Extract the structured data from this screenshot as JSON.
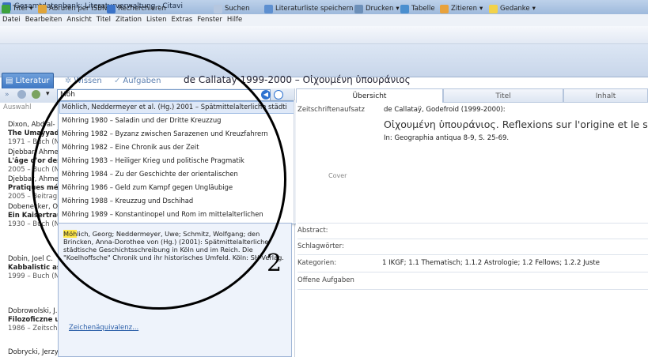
{
  "window": {
    "title": "Gesamtdatenbank: Literaturverwaltung - Citavi"
  },
  "menu": [
    "Datei",
    "Bearbeiten",
    "Ansicht",
    "Titel",
    "Zitation",
    "Listen",
    "Extras",
    "Fenster",
    "Hilfe"
  ],
  "toolbar": {
    "title": "Titel",
    "isbn": "Abrufen per ISBN",
    "research": "Recherchieren",
    "search": "Suchen",
    "save_list": "Literaturliste speichern",
    "print": "Drucken",
    "table": "Tabelle",
    "cite": "Zitieren",
    "idea": "Gedanke"
  },
  "modes": {
    "literature": "Literatur",
    "knowledge": "Wissen",
    "tasks": "Aufgaben"
  },
  "reference_title": "de Callatay 1999-2000 – Οἰχουμένη ὑπουράνιος",
  "search": {
    "query": "Möh",
    "filter": "Auswahl"
  },
  "list": [
    {
      "author": "Dixon, Abd al-",
      "title": "The Umayyad c",
      "meta": "1971 – Buch (N"
    },
    {
      "author": "Djebbar, Ahme",
      "title": "L'âge d'or des",
      "meta": "2005 – Buch (N"
    },
    {
      "author": "Djebbar, Ahme",
      "title": "Pratiques métr",
      "meta": "2005 – Beitrag"
    },
    {
      "author": "Dobenecker, O",
      "title": "Ein Kaisertrau",
      "meta": "1930 – Buch (N"
    },
    {
      "author": "Dobin, Joel C.",
      "title": "Kabbalistic astr",
      "meta": "1999 – Buch (N"
    },
    {
      "author": "Dobrowolski, J.",
      "title": "Filozoficzne uw",
      "meta": "1986 – Zeitschr"
    },
    {
      "author": "Dobrycki, Jerzy",
      "title": "",
      "meta": ""
    }
  ],
  "suggestions": [
    "Möhlich, Neddermeyer et al. (Hg.) 2001 – Spätmittelalterliche städtische...",
    "Möhring 1980 – Saladin und der Dritte Kreuzzug",
    "Möhring 1982 – Byzanz zwischen Sarazenen und Kreuzfahrern",
    "Möhring 1982 – Eine Chronik aus der Zeit",
    "Möhring 1983 – Heiliger Krieg und politische Pragmatik",
    "Möhring 1984 – Zu der Geschichte der orientalischen",
    "Möhring 1986 – Geld zum Kampf gegen Ungläubige",
    "Möhring 1988 – Kreuzzug und Dschihad",
    "Möhring 1989 – Konstantinopel und Rom im mittelalterlichen"
  ],
  "preview": {
    "highlight": "Möh",
    "text": "lich, Georg; Neddermeyer, Uwe; Schmitz, Wolfgang; den Brincken, Anna-Dorothee von (Hg.) (2001): Spätmittelalterliche städtische Geschichtsschreibung in Köln und im Reich. Die \"Koelhoffsche\" Chronik und ihr historisches Umfeld. Köln: SH-Verlag."
  },
  "zeichen_link": "Zeichenäquivalenz...",
  "tabs": {
    "overview": "Übersicht",
    "title": "Titel",
    "content": "Inhalt"
  },
  "detail": {
    "type": "Zeitschriftenaufsatz",
    "author": "de Callataÿ, Godefroid (1999-2000):",
    "title": "Οἰχουμένη ὑπουράνιος. Reflexions sur l'origine et le sens",
    "in": "In: Geographia antiqua 8-9, S. 25-69.",
    "cover": "Cover",
    "abstract_label": "Abstract:",
    "keywords_label": "Schlagwörter:",
    "categories_label": "Kategorien:",
    "categories_value": "1 IKGF; 1.1 Thematisch; 1.1.2 Astrologie; 1.2 Fellows; 1.2.2 Juste",
    "tasks_label": "Offene Aufgaben"
  },
  "annotation": {
    "digit": "2"
  },
  "colors": {
    "accent": "#3f78c4",
    "highlight": "#ffe84a"
  }
}
